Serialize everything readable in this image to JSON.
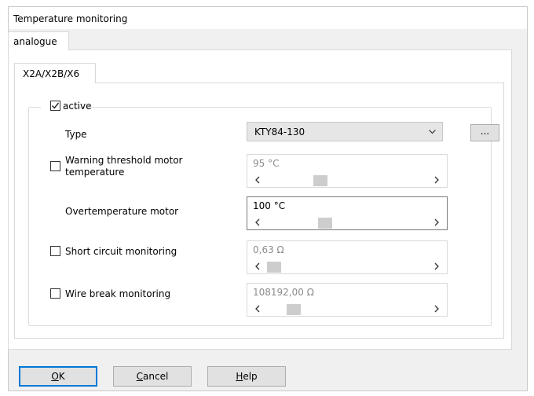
{
  "window": {
    "title": "Temperature monitoring"
  },
  "tabs": {
    "outer": "analogue",
    "inner": "X2A/X2B/X6"
  },
  "group": {
    "active_label": "active",
    "active_checked": true,
    "type_label": "Type",
    "type_value": "KTY84-130",
    "more_button": "..."
  },
  "rows": [
    {
      "label_line1": "Warning threshold motor",
      "label_line2": "temperature",
      "checked": false,
      "value": "95 °C",
      "slider_position": 0.32,
      "enabled": false
    },
    {
      "label": "Overtemperature motor",
      "value": "100 °C",
      "slider_position": 0.35,
      "enabled": true
    },
    {
      "label": "Short circuit monitoring",
      "checked": false,
      "value": "0,63 Ω",
      "slider_position": 0.01,
      "enabled": false
    },
    {
      "label": "Wire break monitoring",
      "checked": false,
      "value": "108192,00 Ω",
      "slider_position": 0.14,
      "enabled": false
    }
  ],
  "buttons": {
    "ok_mnemonic": "O",
    "ok_rest": "K",
    "cancel_mnemonic": "C",
    "cancel_rest": "ancel",
    "help_mnemonic": "H",
    "help_rest": "elp"
  },
  "icons": {
    "left_arrow": "‹",
    "right_arrow": "›",
    "chevron_down": "chevron-down-icon"
  },
  "colors": {
    "dialog_bg": "#f0f0f0",
    "default_button_border": "#0078d7",
    "disabled_text": "#8c8c8c"
  }
}
